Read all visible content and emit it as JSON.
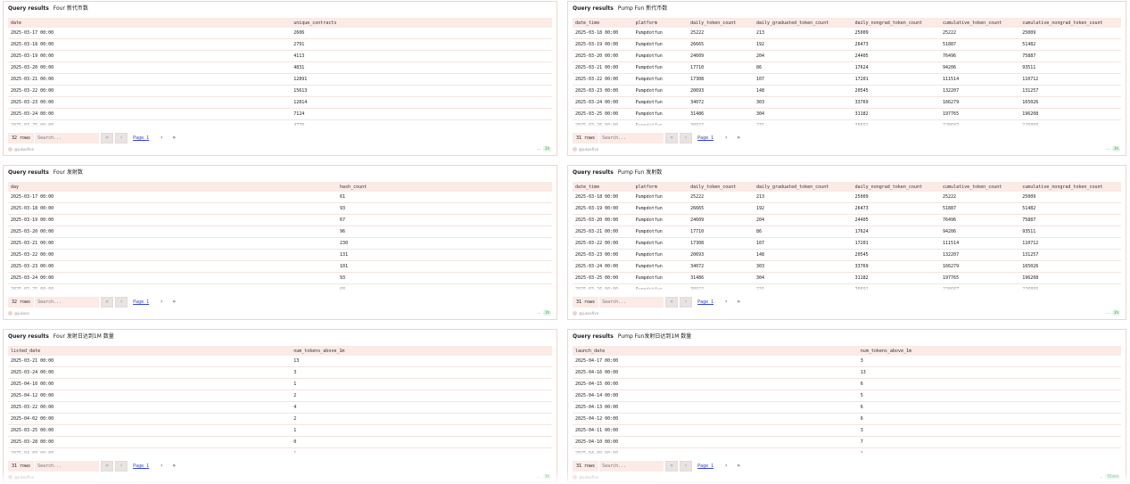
{
  "common": {
    "query_results_label": "Query results",
    "search_placeholder": "Search...",
    "page_label": "Page 1",
    "first_icon": "«",
    "prev_icon": "‹",
    "next_icon": "›",
    "last_icon": "»",
    "more_icon": "···"
  },
  "panels": [
    {
      "title": "Four 新代币数",
      "columns": [
        "date",
        "unique_contracts"
      ],
      "rows": [
        [
          "2025-03-17 00:00",
          "2606"
        ],
        [
          "2025-03-18 00:00",
          "2791"
        ],
        [
          "2025-03-19 00:00",
          "4113"
        ],
        [
          "2025-03-20 00:00",
          "4831"
        ],
        [
          "2025-03-21 00:00",
          "12891"
        ],
        [
          "2025-03-22 00:00",
          "15613"
        ],
        [
          "2025-03-23 00:00",
          "12814"
        ],
        [
          "2025-03-24 00:00",
          "7124"
        ],
        [
          "2025-03-25 00:00",
          "4770"
        ]
      ],
      "row_count": "32 rows",
      "credit": "@jukoofive",
      "age": "1h"
    },
    {
      "title": "Pump Fun 新代币数",
      "columns": [
        "date_time",
        "platform",
        "daily_token_count",
        "daily_graduated_token_count",
        "daily_nongrad_token_count",
        "cumulative_token_count",
        "cumulative_nongrad_token_count"
      ],
      "rows": [
        [
          "2025-03-18 00:00",
          "Pumpdotfun",
          "25222",
          "213",
          "25009",
          "25222",
          "25009"
        ],
        [
          "2025-03-19 00:00",
          "Pumpdotfun",
          "26665",
          "192",
          "26473",
          "51887",
          "51482"
        ],
        [
          "2025-03-20 00:00",
          "Pumpdotfun",
          "24609",
          "204",
          "24405",
          "76496",
          "75887"
        ],
        [
          "2025-03-21 00:00",
          "Pumpdotfun",
          "17710",
          "86",
          "17624",
          "94206",
          "93511"
        ],
        [
          "2025-03-22 00:00",
          "Pumpdotfun",
          "17308",
          "107",
          "17201",
          "111514",
          "110712"
        ],
        [
          "2025-03-23 00:00",
          "Pumpdotfun",
          "20693",
          "148",
          "20545",
          "132207",
          "131257"
        ],
        [
          "2025-03-24 00:00",
          "Pumpdotfun",
          "34072",
          "303",
          "33769",
          "166279",
          "165026"
        ],
        [
          "2025-03-25 00:00",
          "Pumpdotfun",
          "31486",
          "304",
          "31182",
          "197765",
          "196208"
        ],
        [
          "2025-03-26 00:00",
          "Pumpdotfun",
          "30922",
          "231",
          "30691",
          "228687",
          "226899"
        ]
      ],
      "row_count": "31 rows",
      "credit": "@jukoofive",
      "age": "1h"
    },
    {
      "title": "Four 发射数",
      "columns": [
        "day",
        "hash_count"
      ],
      "rows": [
        [
          "2025-03-17 00:00",
          "61"
        ],
        [
          "2025-03-18 00:00",
          "93"
        ],
        [
          "2025-03-19 00:00",
          "67"
        ],
        [
          "2025-03-20 00:00",
          "96"
        ],
        [
          "2025-03-21 00:00",
          "230"
        ],
        [
          "2025-03-22 00:00",
          "131"
        ],
        [
          "2025-03-23 00:00",
          "101"
        ],
        [
          "2025-03-24 00:00",
          "93"
        ],
        [
          "2025-03-25 00:00",
          "68"
        ]
      ],
      "row_count": "32 rows",
      "credit": "@jukoos",
      "age": "1h"
    },
    {
      "title": "Pump Fun 发射数",
      "columns": [
        "date_time",
        "platform",
        "daily_token_count",
        "daily_graduated_token_count",
        "daily_nongrad_token_count",
        "cumulative_token_count",
        "cumulative_nongrad_token_count"
      ],
      "rows": [
        [
          "2025-03-18 00:00",
          "Pumpdotfun",
          "25222",
          "213",
          "25009",
          "25222",
          "25009"
        ],
        [
          "2025-03-19 00:00",
          "Pumpdotfun",
          "26665",
          "192",
          "26473",
          "51887",
          "51482"
        ],
        [
          "2025-03-20 00:00",
          "Pumpdotfun",
          "24609",
          "204",
          "24405",
          "76496",
          "75887"
        ],
        [
          "2025-03-21 00:00",
          "Pumpdotfun",
          "17710",
          "86",
          "17624",
          "94206",
          "93511"
        ],
        [
          "2025-03-22 00:00",
          "Pumpdotfun",
          "17308",
          "107",
          "17201",
          "111514",
          "110712"
        ],
        [
          "2025-03-23 00:00",
          "Pumpdotfun",
          "20693",
          "148",
          "20545",
          "132207",
          "131257"
        ],
        [
          "2025-03-24 00:00",
          "Pumpdotfun",
          "34072",
          "303",
          "33769",
          "166279",
          "165026"
        ],
        [
          "2025-03-25 00:00",
          "Pumpdotfun",
          "31486",
          "304",
          "31182",
          "197765",
          "196208"
        ],
        [
          "2025-03-26 00:00",
          "Pumpdotfun",
          "30922",
          "231",
          "30691",
          "228687",
          "226899"
        ]
      ],
      "row_count": "31 rows",
      "credit": "@jukoofive",
      "age": "1h"
    },
    {
      "title": "Four 发射日达到1M 数量",
      "columns": [
        "listed_date",
        "num_tokens_above_1m"
      ],
      "rows": [
        [
          "2025-03-21 00:00",
          "13"
        ],
        [
          "2025-03-24 00:00",
          "3"
        ],
        [
          "2025-04-10 00:00",
          "1"
        ],
        [
          "2025-04-12 00:00",
          "2"
        ],
        [
          "2025-03-22 00:00",
          "4"
        ],
        [
          "2025-04-02 00:00",
          "2"
        ],
        [
          "2025-03-25 00:00",
          "1"
        ],
        [
          "2025-03-28 00:00",
          "0"
        ],
        [
          "2025-04-09 00:00",
          "1"
        ]
      ],
      "row_count": "31 rows",
      "credit": "@jukoofive",
      "age": "1h"
    },
    {
      "title": "Pump Fun发射日达到1M 数量",
      "columns": [
        "launch_date",
        "num_tokens_above_1m"
      ],
      "rows": [
        [
          "2025-04-17 00:00",
          "3"
        ],
        [
          "2025-04-16 00:00",
          "13"
        ],
        [
          "2025-04-15 00:00",
          "6"
        ],
        [
          "2025-04-14 00:00",
          "5"
        ],
        [
          "2025-04-13 00:00",
          "6"
        ],
        [
          "2025-04-12 00:00",
          "6"
        ],
        [
          "2025-04-11 00:00",
          "3"
        ],
        [
          "2025-04-10 00:00",
          "7"
        ],
        [
          "2025-04-09 00:00",
          "3"
        ]
      ],
      "row_count": "31 rows",
      "credit": "@jukoofive",
      "age": "55min"
    }
  ]
}
